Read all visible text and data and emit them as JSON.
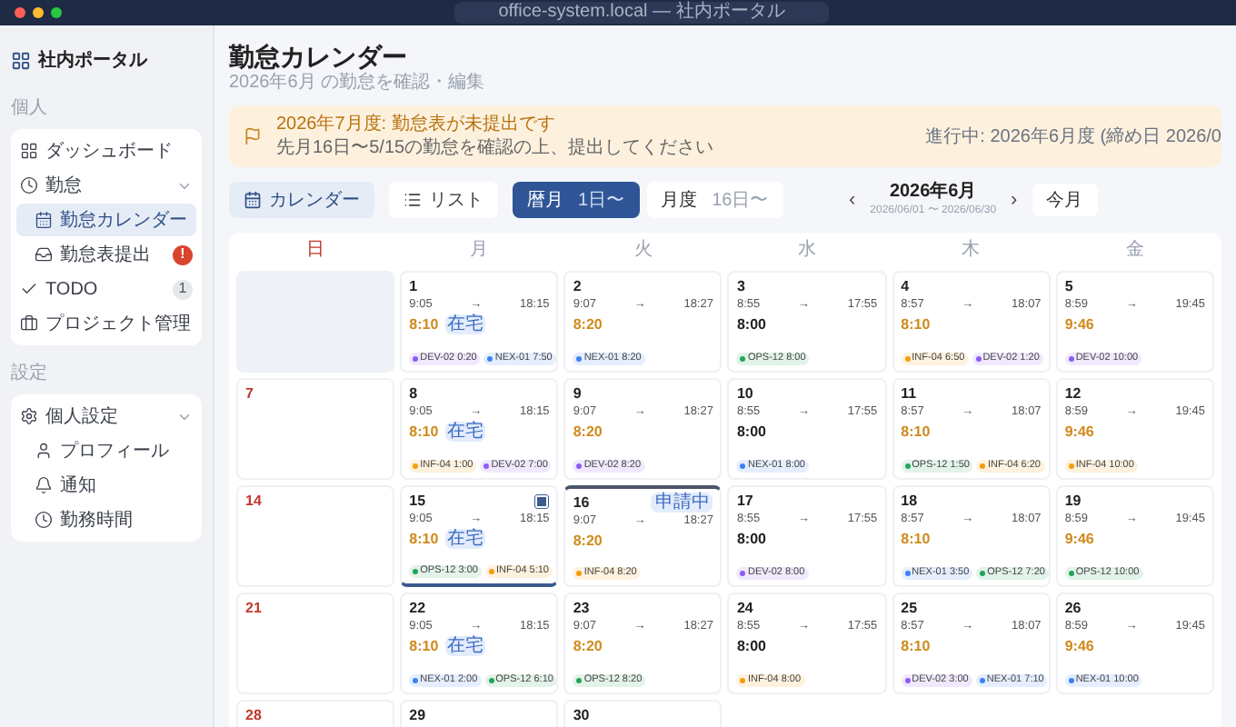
{
  "window": {
    "url": "office-system.local — 社内ポータル"
  },
  "sidebar": {
    "title": "社内ポータル",
    "sections": [
      {
        "label": "個人",
        "items": [
          {
            "label": "ダッシュボード",
            "selected": false
          },
          {
            "label": "勤怠",
            "selected": false,
            "expanded": true,
            "children": [
              {
                "label": "勤怠カレンダー",
                "selected": true
              },
              {
                "label": "勤怠表提出",
                "selected": false,
                "badge": "!",
                "badge_alert": true
              }
            ]
          },
          {
            "label": "TODO",
            "selected": false,
            "badge": "1",
            "badge_alert": false
          },
          {
            "label": "プロジェクト管理",
            "selected": false
          }
        ]
      },
      {
        "label": "設定",
        "items": [
          {
            "label": "個人設定",
            "selected": false,
            "expanded": true,
            "children": [
              {
                "label": "プロフィール",
                "selected": false
              },
              {
                "label": "通知",
                "selected": false
              },
              {
                "label": "勤務時間",
                "selected": false
              }
            ]
          }
        ]
      }
    ]
  },
  "page": {
    "title": "勤怠カレンダー",
    "subtitle": "2026年6月 の勤怠を確認・編集"
  },
  "banner": {
    "title": "2026年7月度: 勤怠表が未提出です",
    "message": "先月16日〜5/15の勤怠を確認の上、提出してください",
    "status": "進行中: 2026年6月度 (締め日 2026/0"
  },
  "toolbar": {
    "views": [
      {
        "label": "カレンダー",
        "selected": true
      },
      {
        "label": "リスト",
        "selected": false
      }
    ],
    "periods": [
      {
        "label": "暦月",
        "range": "1日〜",
        "selected": true
      },
      {
        "label": "月度",
        "range": "16日〜",
        "selected": false
      }
    ],
    "prev": "‹",
    "next": "›",
    "month": "2026年6月",
    "range": "2026/06/01 〜 2026/06/30",
    "today": "今月"
  },
  "calendar": {
    "arrow": "→",
    "weekdays": [
      {
        "label": "日",
        "kind": "sunday"
      },
      {
        "label": "月",
        "kind": "weekday"
      },
      {
        "label": "火",
        "kind": "weekday"
      },
      {
        "label": "水",
        "kind": "weekday"
      },
      {
        "label": "木",
        "kind": "weekday"
      },
      {
        "label": "金",
        "kind": "weekday"
      }
    ],
    "weeks": [
      [
        {
          "kind": "blank"
        },
        {
          "kind": "work",
          "day": "1",
          "in": "9:05",
          "out": "18:15",
          "hours": "8:10",
          "overtime": true,
          "badge": "在宅",
          "tags": [
            {
              "code": "DEV-02 0:20",
              "color": "#8b5cf6"
            },
            {
              "code": "NEX-01 7:50",
              "color": "#3b82f6"
            }
          ]
        },
        {
          "kind": "work",
          "day": "2",
          "in": "9:07",
          "out": "18:27",
          "hours": "8:20",
          "overtime": true,
          "tags": [
            {
              "code": "NEX-01 8:20",
              "color": "#3b82f6"
            }
          ]
        },
        {
          "kind": "work",
          "day": "3",
          "in": "8:55",
          "out": "17:55",
          "hours": "8:00",
          "overtime": false,
          "tags": [
            {
              "code": "OPS-12 8:00",
              "color": "#22a55a"
            }
          ]
        },
        {
          "kind": "work",
          "day": "4",
          "in": "8:57",
          "out": "18:07",
          "hours": "8:10",
          "overtime": true,
          "tags": [
            {
              "code": "INF-04 6:50",
              "color": "#f59e0b"
            },
            {
              "code": "DEV-02 1:20",
              "color": "#8b5cf6"
            }
          ]
        },
        {
          "kind": "work",
          "day": "5",
          "in": "8:59",
          "out": "19:45",
          "hours": "9:46",
          "overtime": true,
          "tags": [
            {
              "code": "DEV-02 10:00",
              "color": "#8b5cf6"
            }
          ]
        }
      ],
      [
        {
          "kind": "sunday",
          "day": "7"
        },
        {
          "kind": "work",
          "day": "8",
          "in": "9:05",
          "out": "18:15",
          "hours": "8:10",
          "overtime": true,
          "badge": "在宅",
          "tags": [
            {
              "code": "INF-04 1:00",
              "color": "#f59e0b"
            },
            {
              "code": "DEV-02 7:00",
              "color": "#8b5cf6"
            }
          ]
        },
        {
          "kind": "work",
          "day": "9",
          "in": "9:07",
          "out": "18:27",
          "hours": "8:20",
          "overtime": true,
          "tags": [
            {
              "code": "DEV-02 8:20",
              "color": "#8b5cf6"
            }
          ]
        },
        {
          "kind": "work",
          "day": "10",
          "in": "8:55",
          "out": "17:55",
          "hours": "8:00",
          "overtime": false,
          "tags": [
            {
              "code": "NEX-01 8:00",
              "color": "#3b82f6"
            }
          ]
        },
        {
          "kind": "work",
          "day": "11",
          "in": "8:57",
          "out": "18:07",
          "hours": "8:10",
          "overtime": true,
          "tags": [
            {
              "code": "OPS-12 1:50",
              "color": "#22a55a"
            },
            {
              "code": "INF-04 6:20",
              "color": "#f59e0b"
            }
          ]
        },
        {
          "kind": "work",
          "day": "12",
          "in": "8:59",
          "out": "19:45",
          "hours": "9:46",
          "overtime": true,
          "tags": [
            {
              "code": "INF-04 10:00",
              "color": "#f59e0b"
            }
          ]
        }
      ],
      [
        {
          "kind": "sunday",
          "day": "14"
        },
        {
          "kind": "work",
          "day": "15",
          "in": "9:05",
          "out": "18:15",
          "hours": "8:10",
          "overtime": true,
          "badge": "在宅",
          "selected": true,
          "memo": true,
          "tags": [
            {
              "code": "OPS-12 3:00",
              "color": "#22a55a"
            },
            {
              "code": "INF-04 5:10",
              "color": "#f59e0b"
            }
          ]
        },
        {
          "kind": "work",
          "day": "16",
          "in": "9:07",
          "out": "18:27",
          "hours": "8:20",
          "overtime": true,
          "label": "申請中",
          "today": true,
          "tags": [
            {
              "code": "INF-04 8:20",
              "color": "#f59e0b"
            }
          ]
        },
        {
          "kind": "work",
          "day": "17",
          "in": "8:55",
          "out": "17:55",
          "hours": "8:00",
          "overtime": false,
          "tags": [
            {
              "code": "DEV-02 8:00",
              "color": "#8b5cf6"
            }
          ]
        },
        {
          "kind": "work",
          "day": "18",
          "in": "8:57",
          "out": "18:07",
          "hours": "8:10",
          "overtime": true,
          "tags": [
            {
              "code": "NEX-01 3:50",
              "color": "#3b82f6"
            },
            {
              "code": "OPS-12 7:20",
              "color": "#22a55a"
            }
          ]
        },
        {
          "kind": "work",
          "day": "19",
          "in": "8:59",
          "out": "19:45",
          "hours": "9:46",
          "overtime": true,
          "tags": [
            {
              "code": "OPS-12 10:00",
              "color": "#22a55a"
            }
          ]
        }
      ],
      [
        {
          "kind": "sunday",
          "day": "21"
        },
        {
          "kind": "work",
          "day": "22",
          "in": "9:05",
          "out": "18:15",
          "hours": "8:10",
          "overtime": true,
          "badge": "在宅",
          "tags": [
            {
              "code": "NEX-01 2:00",
              "color": "#3b82f6"
            },
            {
              "code": "OPS-12 6:10",
              "color": "#22a55a"
            }
          ]
        },
        {
          "kind": "work",
          "day": "23",
          "in": "9:07",
          "out": "18:27",
          "hours": "8:20",
          "overtime": true,
          "tags": [
            {
              "code": "OPS-12 8:20",
              "color": "#22a55a"
            }
          ]
        },
        {
          "kind": "work",
          "day": "24",
          "in": "8:55",
          "out": "17:55",
          "hours": "8:00",
          "overtime": false,
          "tags": [
            {
              "code": "INF-04 8:00",
              "color": "#f59e0b"
            }
          ]
        },
        {
          "kind": "work",
          "day": "25",
          "in": "8:57",
          "out": "18:07",
          "hours": "8:10",
          "overtime": true,
          "tags": [
            {
              "code": "DEV-02 3:00",
              "color": "#8b5cf6"
            },
            {
              "code": "NEX-01 7:10",
              "color": "#3b82f6"
            }
          ]
        },
        {
          "kind": "work",
          "day": "26",
          "in": "8:59",
          "out": "19:45",
          "hours": "9:46",
          "overtime": true,
          "tags": [
            {
              "code": "NEX-01 10:00",
              "color": "#3b82f6"
            }
          ]
        }
      ],
      [
        {
          "kind": "sunday",
          "day": "28"
        },
        {
          "kind": "work",
          "day": "29"
        },
        {
          "kind": "work",
          "day": "30"
        }
      ]
    ]
  }
}
